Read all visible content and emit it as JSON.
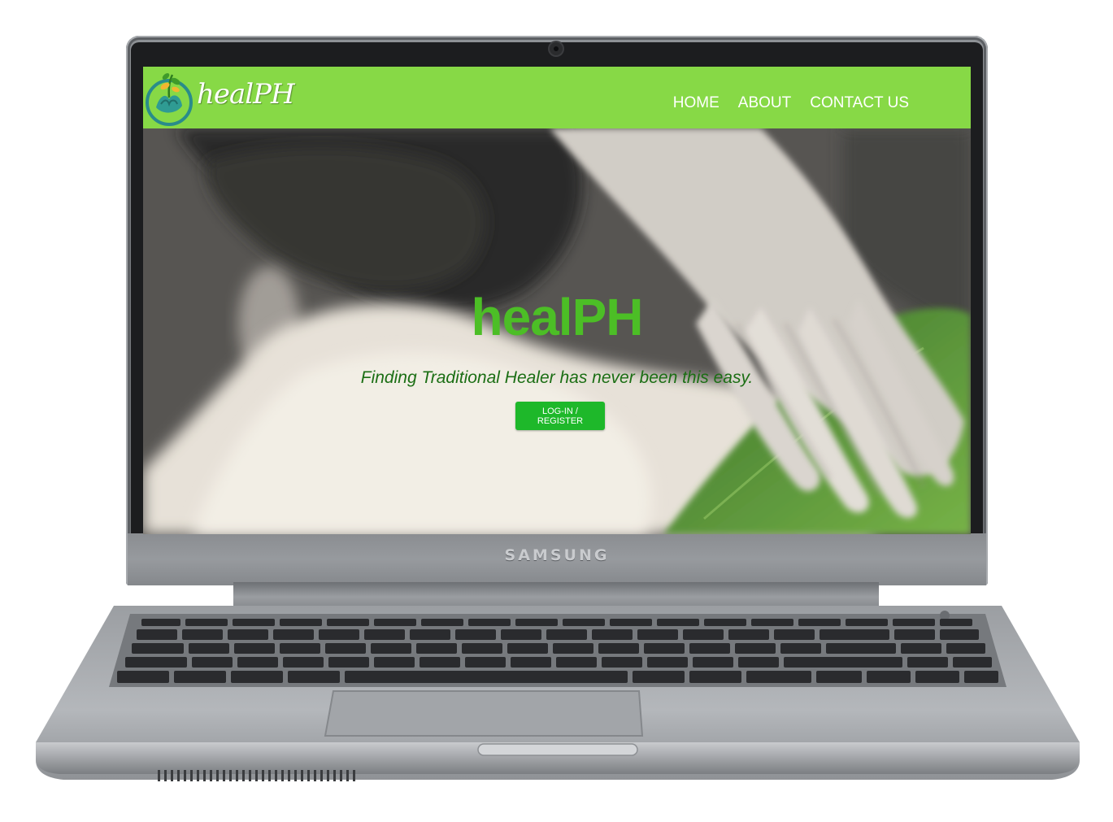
{
  "device": {
    "brand": "SAMSUNG"
  },
  "site": {
    "logo_text": "healPH",
    "nav": [
      {
        "label": "HOME"
      },
      {
        "label": "ABOUT"
      },
      {
        "label": "CONTACT US"
      }
    ],
    "hero": {
      "title": "healPH",
      "subtitle": "Finding Traditional Healer has never been this easy.",
      "cta_label": "LOG-IN / REGISTER"
    }
  },
  "colors": {
    "navbar": "#87d946",
    "hero_title": "#4cbe26",
    "subtitle": "#1b6e14",
    "button": "#1eb82a"
  },
  "icons": {
    "logo": "hands-leaf-icon",
    "webcam": "webcam-icon",
    "power": "power-button-icon"
  }
}
